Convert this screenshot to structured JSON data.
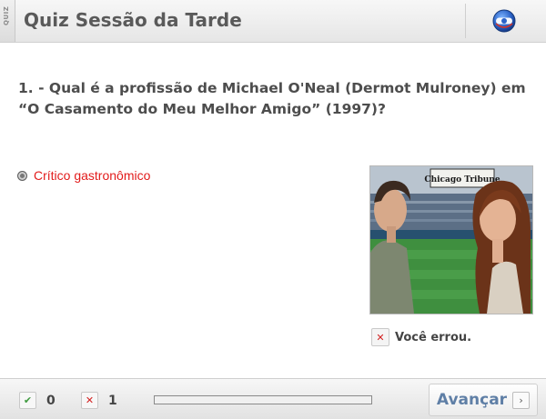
{
  "header": {
    "side_tab": "QUIZ",
    "title": "Quiz Sessão da Tarde",
    "logo_icon": "globo-logo-icon"
  },
  "question": {
    "text": "1. - Qual é a profissão de Michael O'Neal (Dermot Mulroney) em “O Casamento do Meu Melhor Amigo” (1997)?"
  },
  "answer": {
    "label": "Crítico gastronômico",
    "selected": true,
    "color": "#e21b1b"
  },
  "photo": {
    "sign_text": "Chicago Tribune"
  },
  "result": {
    "icon": "x-icon",
    "text": "Você errou."
  },
  "footer": {
    "correct_count": "0",
    "wrong_count": "1",
    "progress": 0,
    "next_label": "Avançar",
    "next_icon": "chevron-right-icon"
  },
  "colors": {
    "accent": "#5f7fa6",
    "wrong": "#d21f1f",
    "correct": "#3f9a3f"
  }
}
